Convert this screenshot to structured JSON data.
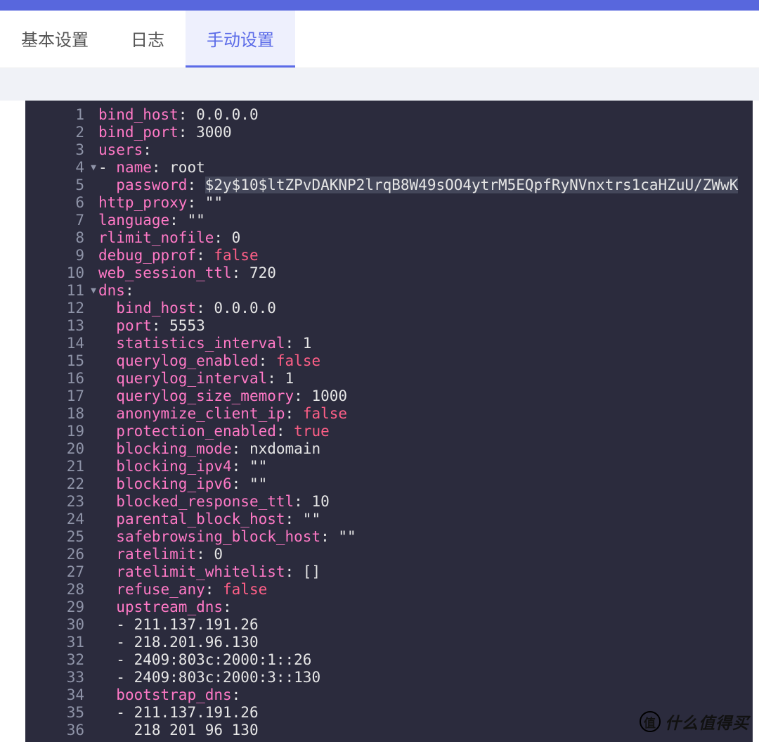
{
  "tabs": {
    "basic": "基本设置",
    "logs": "日志",
    "manual": "手动设置"
  },
  "watermark": {
    "badge": "值",
    "text": "什么值得买"
  },
  "lines": [
    {
      "n": 1,
      "fold": "",
      "indent": 0,
      "key": "bind_host",
      "after": ": 0.0.0.0"
    },
    {
      "n": 2,
      "fold": "",
      "indent": 0,
      "key": "bind_port",
      "after": ": 3000"
    },
    {
      "n": 3,
      "fold": "",
      "indent": 0,
      "key": "users",
      "after": ":"
    },
    {
      "n": 4,
      "fold": "▼",
      "indent": 0,
      "prefix": "- ",
      "key": "name",
      "after": ": root"
    },
    {
      "n": 5,
      "fold": "",
      "indent": 1,
      "key": "password",
      "after": ": ",
      "sel": "$2y$10$ltZPvDAKNP2lrqB8W49sOO4ytrM5EQpfRyNVnxtrs1caHZuU/ZWwK"
    },
    {
      "n": 6,
      "fold": "",
      "indent": 0,
      "key": "http_proxy",
      "after": ": \"\""
    },
    {
      "n": 7,
      "fold": "",
      "indent": 0,
      "key": "language",
      "after": ": \"\""
    },
    {
      "n": 8,
      "fold": "",
      "indent": 0,
      "key": "rlimit_nofile",
      "after": ": 0"
    },
    {
      "n": 9,
      "fold": "",
      "indent": 0,
      "key": "debug_pprof",
      "after": ": ",
      "boolv": "false"
    },
    {
      "n": 10,
      "fold": "",
      "indent": 0,
      "key": "web_session_ttl",
      "after": ": 720"
    },
    {
      "n": 11,
      "fold": "▼",
      "indent": 0,
      "key": "dns",
      "after": ":"
    },
    {
      "n": 12,
      "fold": "",
      "indent": 1,
      "key": "bind_host",
      "after": ": 0.0.0.0"
    },
    {
      "n": 13,
      "fold": "",
      "indent": 1,
      "key": "port",
      "after": ": 5553"
    },
    {
      "n": 14,
      "fold": "",
      "indent": 1,
      "key": "statistics_interval",
      "after": ": 1"
    },
    {
      "n": 15,
      "fold": "",
      "indent": 1,
      "key": "querylog_enabled",
      "after": ": ",
      "boolv": "false"
    },
    {
      "n": 16,
      "fold": "",
      "indent": 1,
      "key": "querylog_interval",
      "after": ": 1"
    },
    {
      "n": 17,
      "fold": "",
      "indent": 1,
      "key": "querylog_size_memory",
      "after": ": 1000"
    },
    {
      "n": 18,
      "fold": "",
      "indent": 1,
      "key": "anonymize_client_ip",
      "after": ": ",
      "boolv": "false"
    },
    {
      "n": 19,
      "fold": "",
      "indent": 1,
      "key": "protection_enabled",
      "after": ": ",
      "boolv": "true"
    },
    {
      "n": 20,
      "fold": "",
      "indent": 1,
      "key": "blocking_mode",
      "after": ": nxdomain"
    },
    {
      "n": 21,
      "fold": "",
      "indent": 1,
      "key": "blocking_ipv4",
      "after": ": \"\""
    },
    {
      "n": 22,
      "fold": "",
      "indent": 1,
      "key": "blocking_ipv6",
      "after": ": \"\""
    },
    {
      "n": 23,
      "fold": "",
      "indent": 1,
      "key": "blocked_response_ttl",
      "after": ": 10"
    },
    {
      "n": 24,
      "fold": "",
      "indent": 1,
      "key": "parental_block_host",
      "after": ": \"\""
    },
    {
      "n": 25,
      "fold": "",
      "indent": 1,
      "key": "safebrowsing_block_host",
      "after": ": \"\""
    },
    {
      "n": 26,
      "fold": "",
      "indent": 1,
      "key": "ratelimit",
      "after": ": 0"
    },
    {
      "n": 27,
      "fold": "",
      "indent": 1,
      "key": "ratelimit_whitelist",
      "after": ": []"
    },
    {
      "n": 28,
      "fold": "",
      "indent": 1,
      "key": "refuse_any",
      "after": ": ",
      "boolv": "false"
    },
    {
      "n": 29,
      "fold": "",
      "indent": 1,
      "key": "upstream_dns",
      "after": ":"
    },
    {
      "n": 30,
      "fold": "",
      "indent": 1,
      "plain": "- 211.137.191.26"
    },
    {
      "n": 31,
      "fold": "",
      "indent": 1,
      "plain": "- 218.201.96.130"
    },
    {
      "n": 32,
      "fold": "",
      "indent": 1,
      "plain": "- 2409:803c:2000:1::26"
    },
    {
      "n": 33,
      "fold": "",
      "indent": 1,
      "plain": "- 2409:803c:2000:3::130"
    },
    {
      "n": 34,
      "fold": "",
      "indent": 1,
      "key": "bootstrap_dns",
      "after": ":"
    },
    {
      "n": 35,
      "fold": "",
      "indent": 1,
      "plain": "- 211.137.191.26"
    },
    {
      "n": 36,
      "fold": "",
      "indent": 1,
      "plain": "  218 201 96 130"
    }
  ]
}
